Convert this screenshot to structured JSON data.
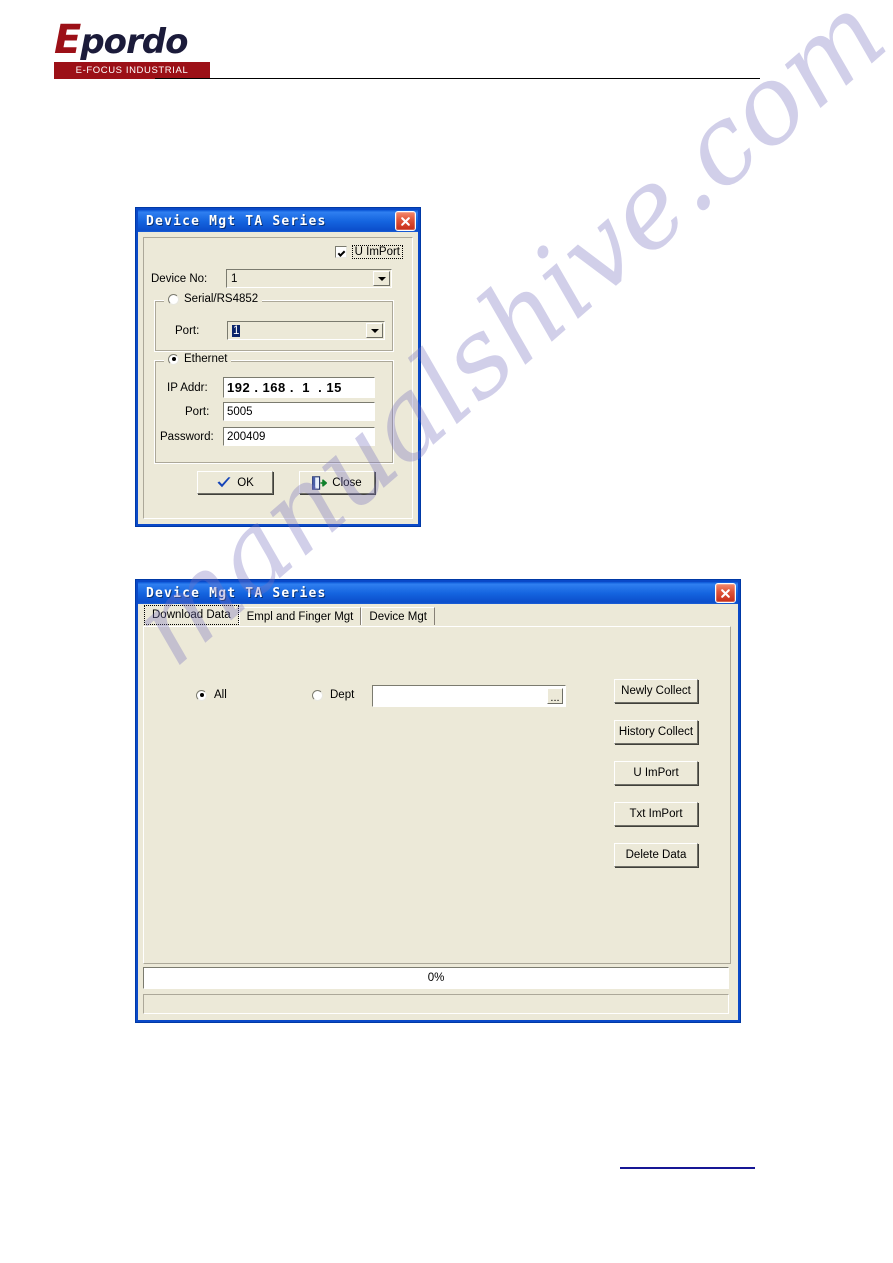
{
  "header": {
    "logo_cap": "E",
    "logo_rest": "pordo",
    "tagline": "E-FOCUS  INDUSTRIAL",
    "brand_red": "#9c1017",
    "brand_navy": "#1b1b3a"
  },
  "watermark": {
    "text": "manualshive.com"
  },
  "dialog1": {
    "title": "Device Mgt TA Series",
    "close_icon": "close-x-icon",
    "uimport": {
      "label": "U ImPort",
      "checked": true
    },
    "device_no": {
      "label": "Device No:",
      "value": "1"
    },
    "serial_group": {
      "label": "Serial/RS4852",
      "selected": false,
      "port_label": "Port:",
      "port_value": "1"
    },
    "ethernet_group": {
      "label": "Ethernet",
      "selected": true,
      "ip_label": "IP Addr:",
      "ip_octets": [
        "192",
        "168",
        "1",
        "15"
      ],
      "port_label": "Port:",
      "port_value": "5005",
      "password_label": "Password:",
      "password_value": "200409"
    },
    "buttons": {
      "ok": "OK",
      "ok_icon": "check-icon",
      "close": "Close",
      "close_icon": "exit-door-icon"
    }
  },
  "dialog2": {
    "title": "Device Mgt TA Series",
    "close_icon": "close-x-icon",
    "tabs": [
      {
        "label": "Download Data",
        "active": true
      },
      {
        "label": "Empl and Finger Mgt",
        "active": false
      },
      {
        "label": "Device Mgt",
        "active": false
      }
    ],
    "scope": {
      "all_label": "All",
      "all_selected": true,
      "dept_label": "Dept",
      "dept_selected": false,
      "dept_value": "",
      "browse_label": "..."
    },
    "actions": [
      "Newly Collect",
      "History Collect",
      "U ImPort",
      "Txt ImPort",
      "Delete Data"
    ],
    "progress": {
      "text": "0%",
      "percent": 0
    }
  }
}
